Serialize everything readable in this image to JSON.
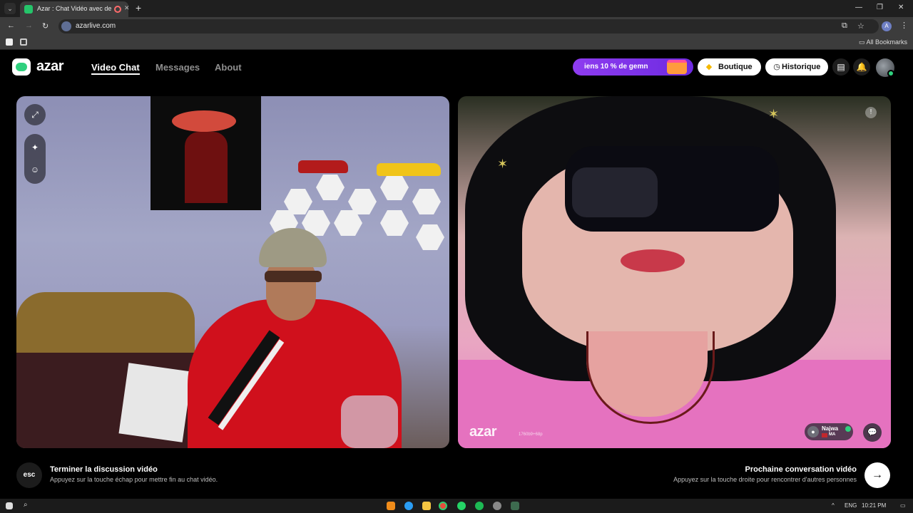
{
  "browser": {
    "tab_title": "Azar : Chat Vidéo avec de n",
    "new_tab": "+",
    "url": "azarlive.com",
    "profile_initial": "A",
    "bookmarks_all": "All Bookmarks",
    "window_controls": [
      "—",
      "❐",
      "✕"
    ]
  },
  "header": {
    "logo_text": "azar",
    "nav": [
      "Video Chat",
      "Messages",
      "About"
    ],
    "promo_text": "iens 10 % de gemn",
    "boutique_label": "Boutique",
    "historique_label": "Historique"
  },
  "right_video": {
    "watermark": "azar",
    "watermark_id": "1760b9+68p",
    "peer_name": "Najwa",
    "peer_country": "MA"
  },
  "bottom": {
    "esc_label": "esc",
    "end_title": "Terminer la discussion vidéo",
    "end_sub": "Appuyez sur la touche échap pour mettre fin au chat vidéo.",
    "next_title": "Prochaine conversation vidéo",
    "next_sub": "Appuyez sur la touche droite pour rencontrer d'autres personnes"
  },
  "taskbar": {
    "lang": "ENG",
    "time": "10:21 PM"
  },
  "colors": {
    "accent_green": "#2fd07e",
    "promo_purple": "#8e3cf0",
    "background": "#000000"
  }
}
